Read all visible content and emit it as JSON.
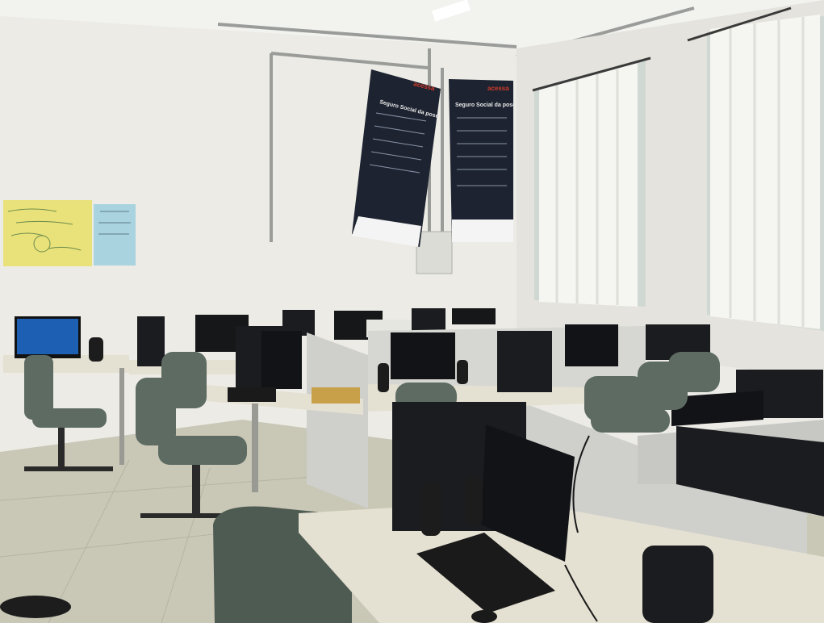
{
  "scene": {
    "description_tag": "computer-lab-photo"
  },
  "banners": [
    {
      "brand": "acessa",
      "title": "Seguro Social da pose"
    },
    {
      "brand": "acessa",
      "title": "Seguro Social da pose"
    }
  ],
  "colors": {
    "wall": "#ecebe6",
    "ceiling": "#f2f2ef",
    "floor": "#c9c7b6",
    "desk": "#e4e0d2",
    "partition": "#cfd0cc",
    "chair": "#5d6b62",
    "pc_black": "#1b1c1f",
    "screen_blue": "#1d5fb3",
    "poster_yellow": "#e9e27a",
    "poster_blue": "#a9d3df",
    "curtain": "#f7f7f2",
    "banner_bg": "#1d2330"
  }
}
